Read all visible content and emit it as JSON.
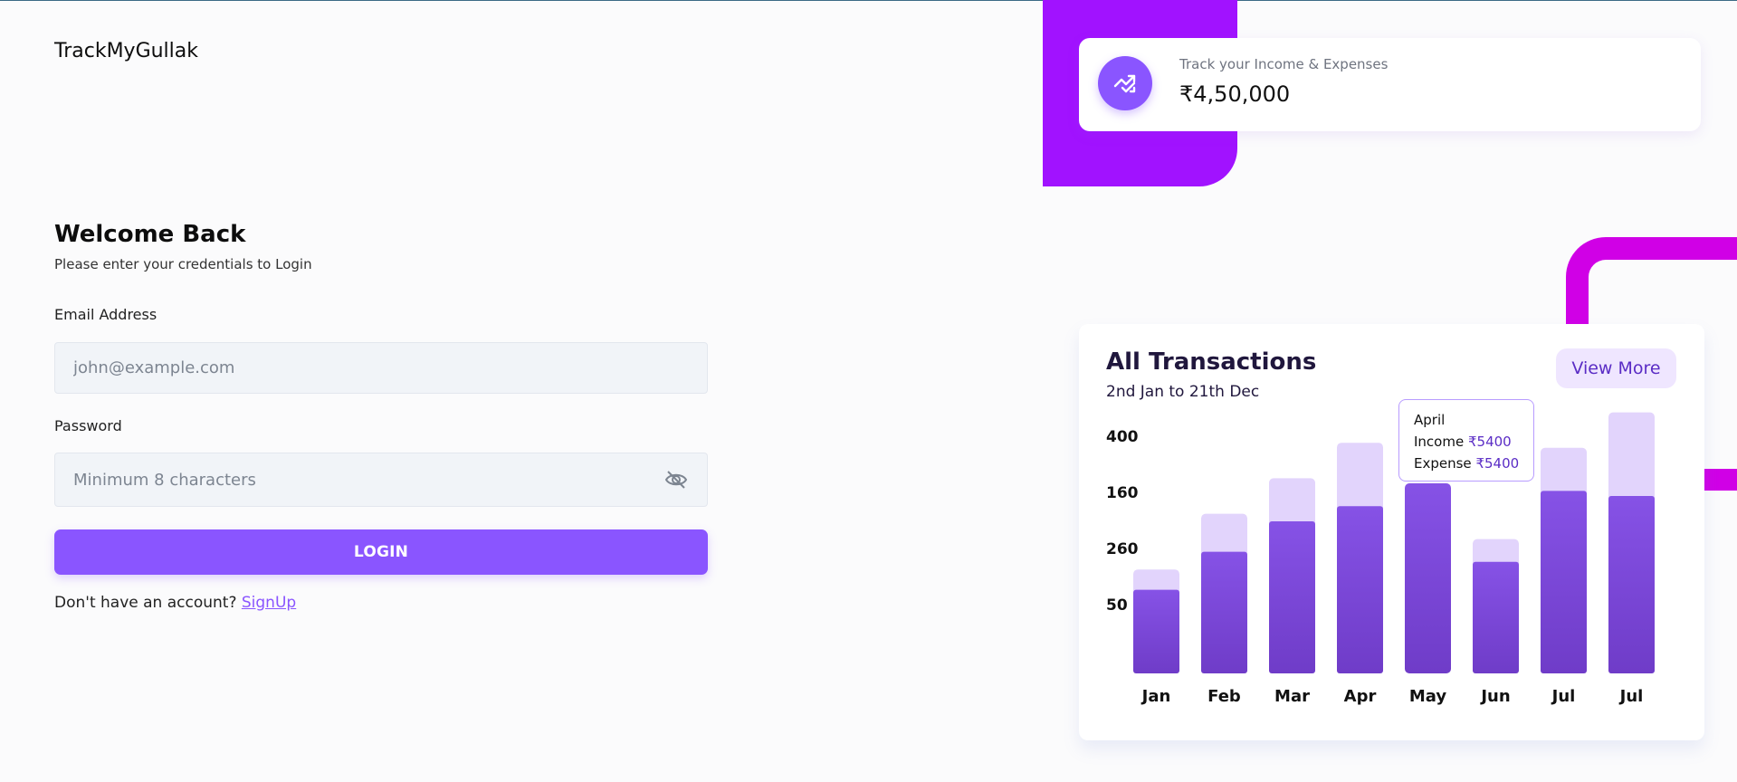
{
  "app": {
    "brand": "TrackMyGullak"
  },
  "login": {
    "title": "Welcome Back",
    "subtitle": "Please enter your credentials to Login",
    "email_label": "Email Address",
    "email_placeholder": "john@example.com",
    "password_label": "Password",
    "password_placeholder": "Minimum 8 characters",
    "login_button": "LOGIN",
    "no_account_text": "Don't have an account?",
    "signup_link": "SignUp"
  },
  "stat": {
    "caption": "Track your Income & Expenses",
    "value": "₹4,50,000",
    "icon": "trending-up-arrows-icon"
  },
  "transactions": {
    "title": "All Transactions",
    "range": "2nd Jan to 21th Dec",
    "view_more": "View More",
    "tooltip": {
      "month": "April",
      "income_label": "Income",
      "income_value": "₹5400",
      "expense_label": "Expense",
      "expense_value": "₹5400"
    }
  },
  "colors": {
    "accent": "#8a55ff",
    "bar_dark": "#7c45dd",
    "bar_light": "#e2d4fc",
    "deco_purple": "#a112ff",
    "deco_pink": "#d000e6"
  },
  "chart_data": {
    "type": "bar",
    "stacked": true,
    "categories": [
      "Jan",
      "Feb",
      "Mar",
      "Apr",
      "May",
      "Jun",
      "Jul",
      "Jul"
    ],
    "y_tick_labels": [
      "400",
      "160",
      "260",
      "50"
    ],
    "series": [
      {
        "values": [
          0.33,
          0.48,
          0.6,
          0.66,
          0.75,
          0.44,
          0.72,
          0.7
        ]
      },
      {
        "values": [
          0.08,
          0.15,
          0.17,
          0.25,
          0.0,
          0.09,
          0.17,
          0.33
        ]
      }
    ]
  }
}
